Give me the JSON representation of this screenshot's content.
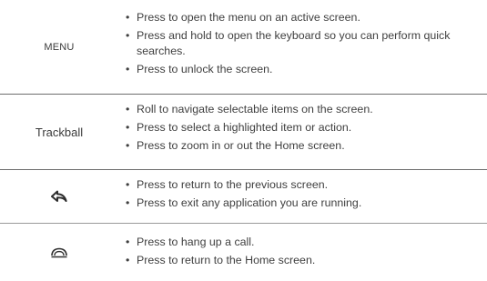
{
  "rows": [
    {
      "key": "MENU",
      "bullets": [
        "Press to open the menu on an active screen.",
        "Press and hold to open the keyboard so you can perform quick searches.",
        "Press to unlock the screen."
      ]
    },
    {
      "key": "Trackball",
      "bullets": [
        "Roll to navigate selectable items on the screen.",
        "Press to select a highlighted item or action.",
        "Press to zoom in or out the Home screen."
      ]
    },
    {
      "key_icon": "back-arrow-icon",
      "bullets": [
        "Press to return to the previous screen.",
        "Press to exit any application you are running."
      ]
    },
    {
      "key_icon": "end-call-icon",
      "bullets": [
        "Press to hang up a call.",
        "Press to return to the Home screen."
      ]
    }
  ]
}
